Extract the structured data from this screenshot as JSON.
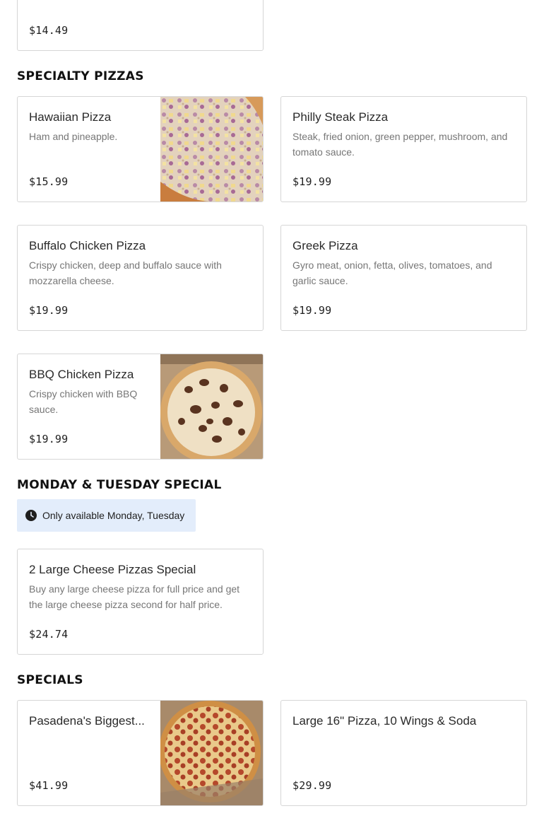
{
  "top_card": {
    "price": "$14.49"
  },
  "sections": {
    "specialty": {
      "title": "SPECIALTY PIZZAS"
    },
    "mon_tue": {
      "title": "MONDAY & TUESDAY SPECIAL",
      "notice": "Only available Monday, Tuesday"
    },
    "specials": {
      "title": "SPECIALS"
    }
  },
  "items": {
    "hawaiian": {
      "name": "Hawaiian Pizza",
      "desc": "Ham and pineapple.",
      "price": "$15.99"
    },
    "philly": {
      "name": "Philly Steak Pizza",
      "desc": "Steak, fried onion, green pepper, mushroom, and tomato sauce.",
      "price": "$19.99"
    },
    "buffalo": {
      "name": "Buffalo Chicken Pizza",
      "desc": "Crispy chicken, deep and buffalo sauce with mozzarella cheese.",
      "price": "$19.99"
    },
    "greek": {
      "name": "Greek Pizza",
      "desc": "Gyro meat, onion, fetta, olives, tomatoes, and garlic sauce.",
      "price": "$19.99"
    },
    "bbq": {
      "name": "BBQ Chicken Pizza",
      "desc": "Crispy chicken with BBQ sauce.",
      "price": "$19.99"
    },
    "two_large": {
      "name": "2 Large Cheese Pizzas Special",
      "desc": "Buy any large cheese pizza for full price and get the large cheese pizza second for half price.",
      "price": "$24.74"
    },
    "pasadena": {
      "name": "Pasadena's Biggest...",
      "price": "$41.99"
    },
    "large16": {
      "name": "Large 16\" Pizza, 10 Wings & Soda",
      "price": "$29.99"
    }
  },
  "icons": {
    "notice_icon": "clock-icon"
  },
  "colors": {
    "notice_bg": "#e3edfb",
    "card_border": "#d6d6d6",
    "desc_text": "#767676"
  }
}
